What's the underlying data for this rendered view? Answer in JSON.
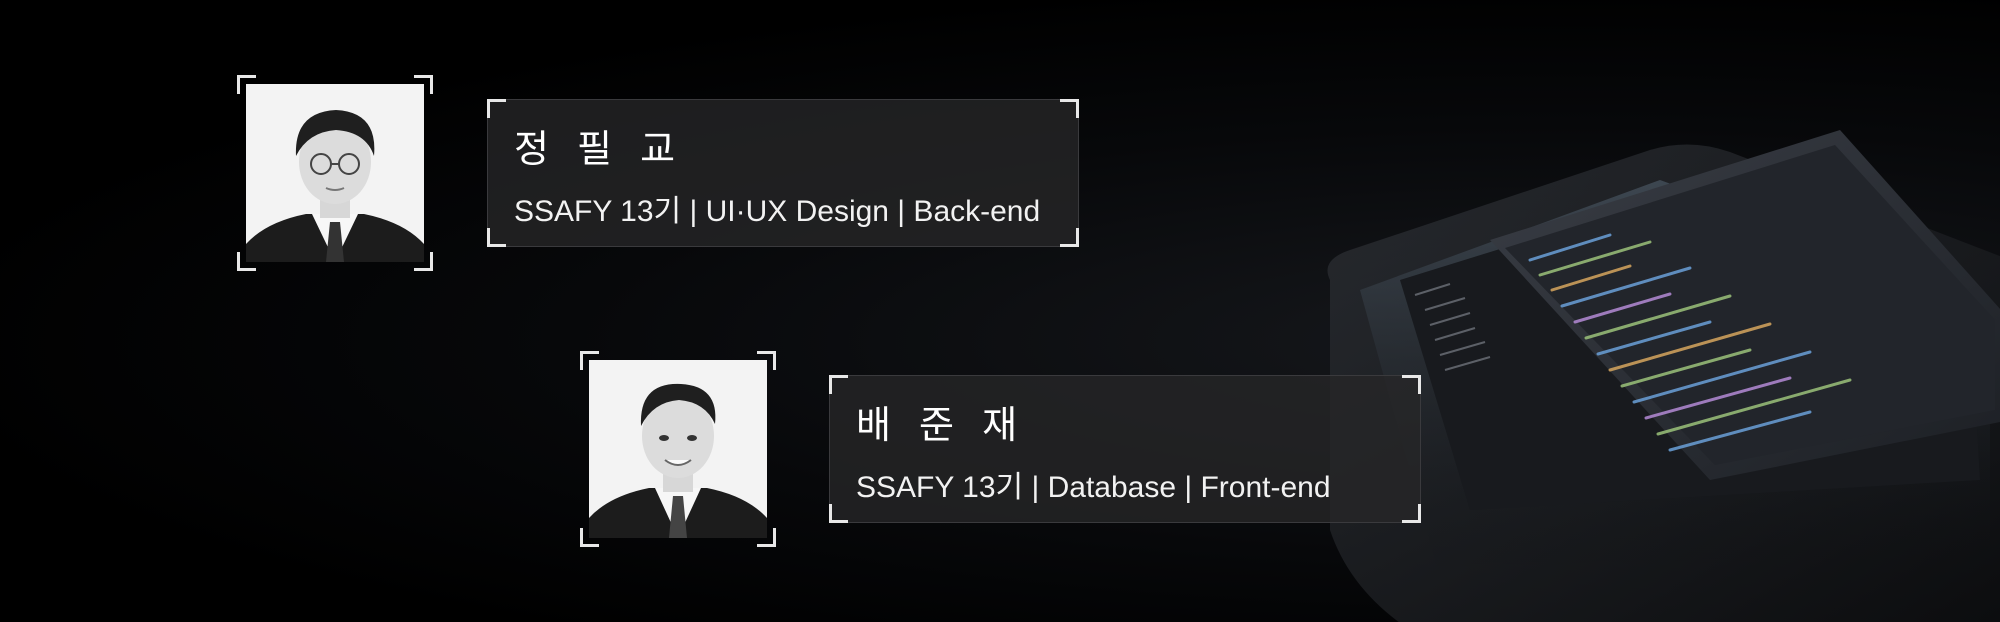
{
  "members": [
    {
      "name": "정 필 교",
      "description": "SSAFY 13기 | UI·UX Design | Back-end"
    },
    {
      "name": "배 준 재",
      "description": "SSAFY 13기 | Database | Front-end"
    }
  ],
  "colors": {
    "background": "#000000",
    "card_background": "#262628",
    "frame": "#e8e8e8",
    "text": "#ffffff"
  }
}
